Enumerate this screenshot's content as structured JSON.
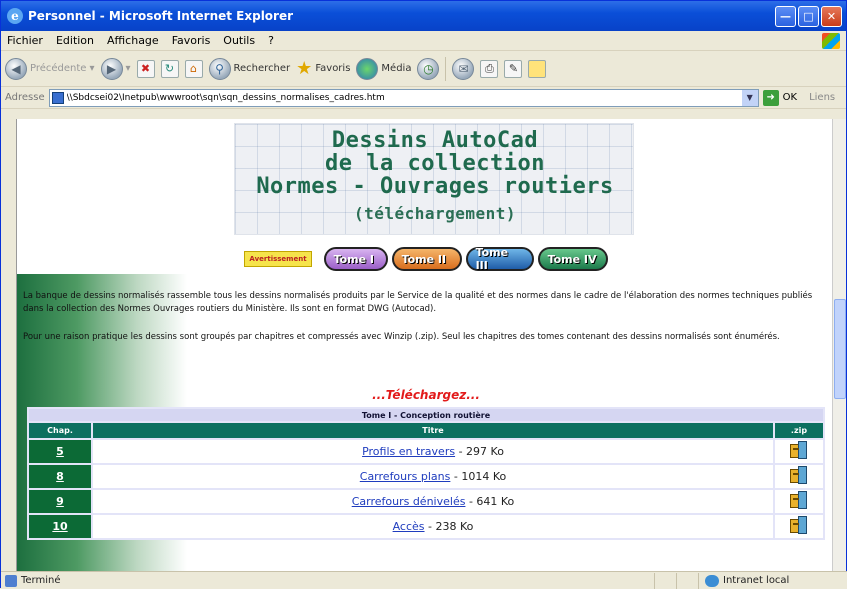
{
  "window": {
    "title": "Personnel - Microsoft Internet Explorer",
    "icon": "ie-logo-icon"
  },
  "menu": [
    "Fichier",
    "Edition",
    "Affichage",
    "Favoris",
    "Outils",
    "?"
  ],
  "toolbar": {
    "back_label": "Précédente",
    "search_label": "Rechercher",
    "favorites_label": "Favoris",
    "media_label": "Média"
  },
  "address": {
    "label": "Adresse",
    "url": "\\\\Sbdcsei02\\Inetpub\\wwwroot\\sqn\\sqn_dessins_normalises_cadres.htm",
    "go_label": "OK",
    "links_label": "Liens"
  },
  "banner": {
    "line1": "Dessins AutoCad",
    "line2": "de la collection",
    "line3": "Normes - Ouvrages routiers",
    "line4": "(téléchargement)"
  },
  "nav": {
    "avertissement": "Avertissement",
    "tomes": [
      "Tome I",
      "Tome II",
      "Tome III",
      "Tome IV"
    ]
  },
  "intro": {
    "p1": "La banque de dessins normalisés rassemble tous les dessins normalisés produits par le Service de la qualité et des normes dans le cadre de l'élaboration des normes techniques publiés dans la collection des Normes Ouvrages routiers du Ministère. Ils sont en format DWG (Autocad).",
    "p2": "Pour une raison pratique les dessins sont groupés par chapitres et compressés avec Winzip (.zip). Seul les chapitres des tomes contenant des dessins normalisés sont énumérés."
  },
  "download": {
    "heading": "...Téléchargez...",
    "tome_title": "Tome I - Conception routière",
    "headers": {
      "chap": "Chap.",
      "titre": "Titre",
      "zip": ".zip"
    },
    "rows": [
      {
        "chap": "5",
        "title": "Profils en travers",
        "size": "- 297 Ko"
      },
      {
        "chap": "8",
        "title": "Carrefours plans",
        "size": "- 1014 Ko"
      },
      {
        "chap": "9",
        "title": "Carrefours dénivelés",
        "size": "- 641 Ko"
      },
      {
        "chap": "10",
        "title": "Accès",
        "size": " - 238 Ko"
      }
    ]
  },
  "status": {
    "text": "Terminé",
    "zone": "Intranet local"
  }
}
